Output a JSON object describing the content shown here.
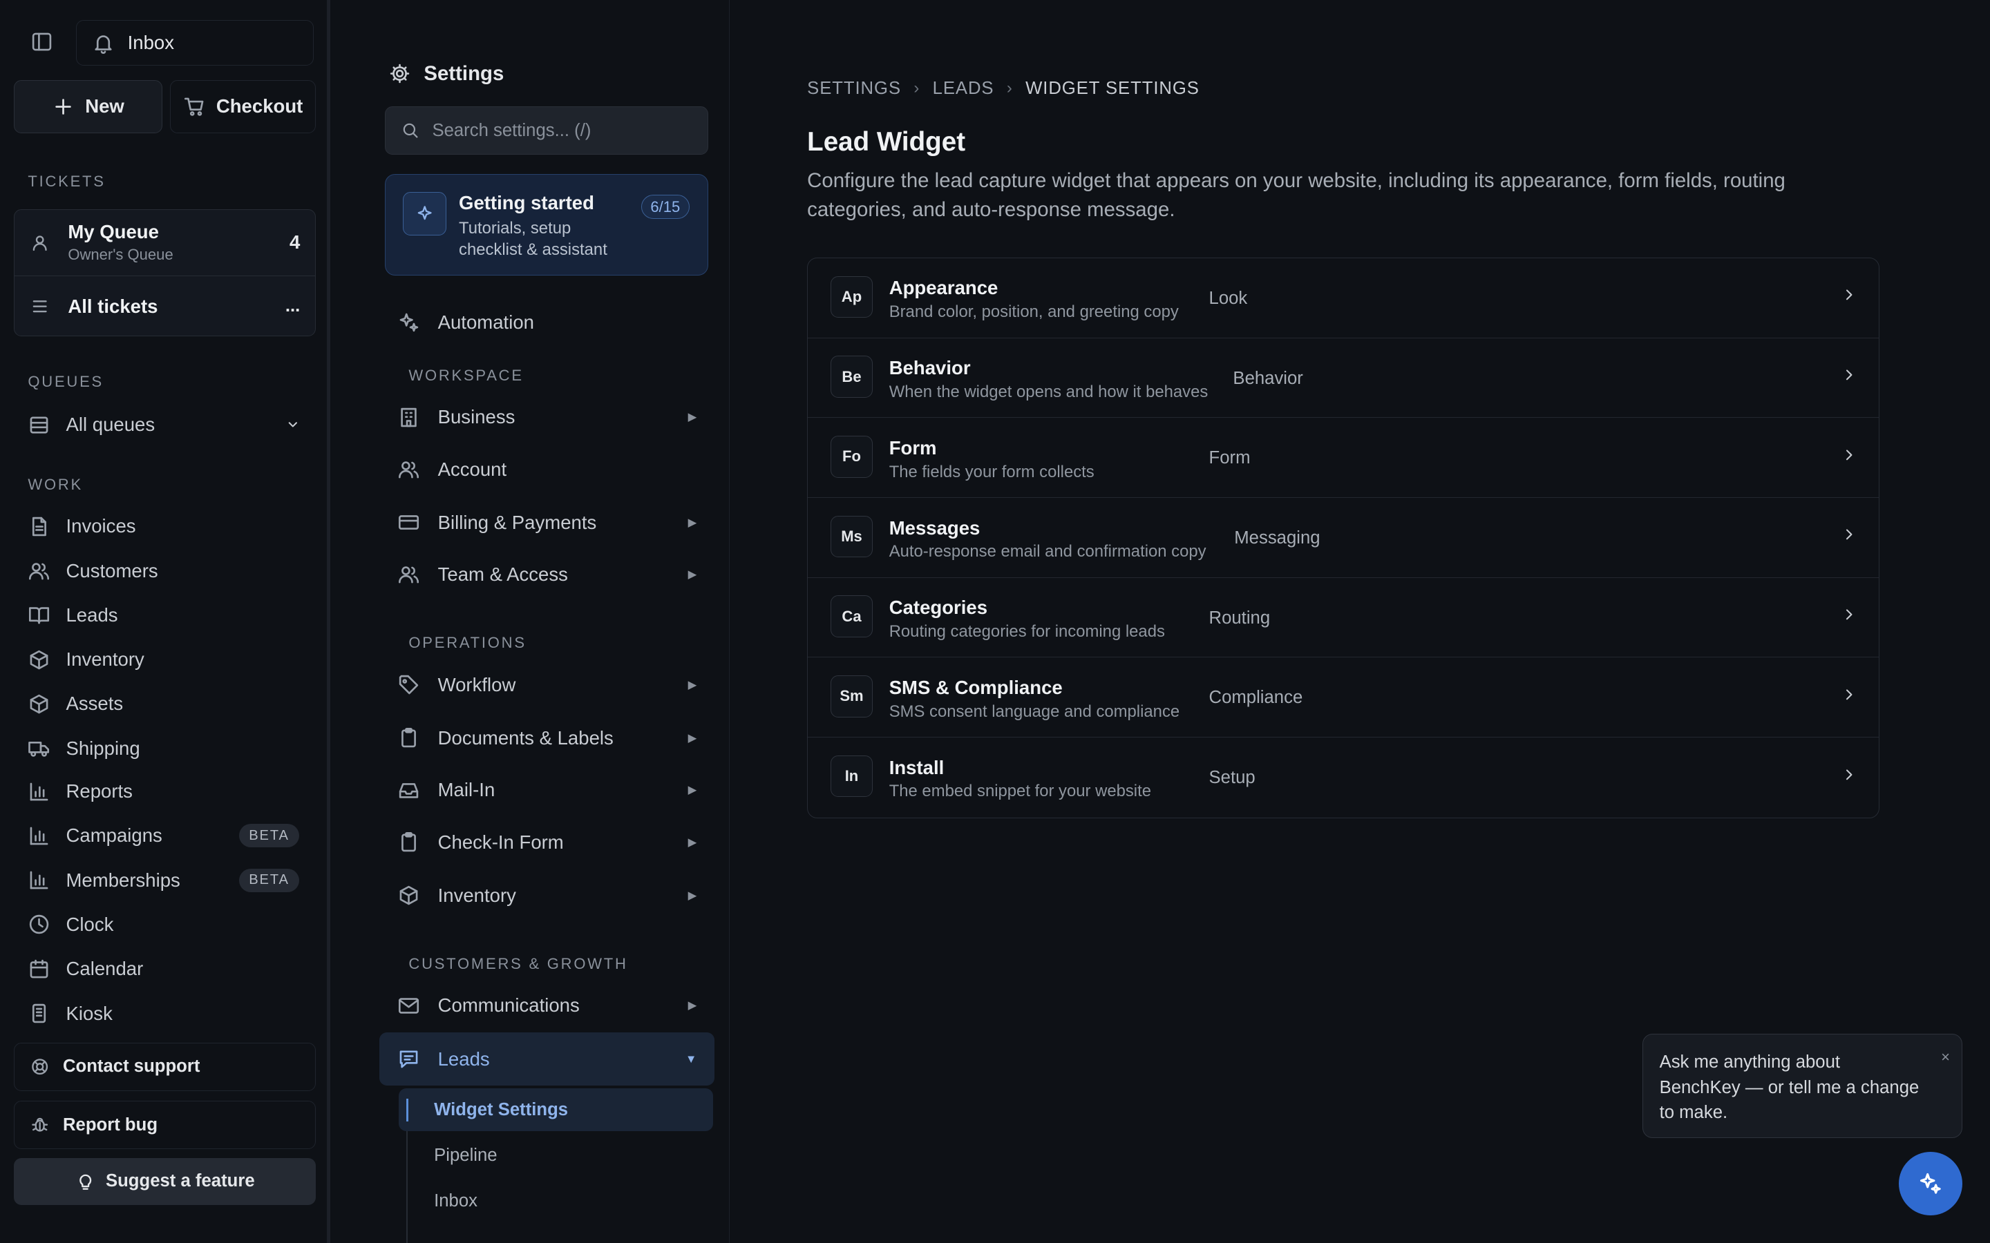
{
  "sidebar": {
    "inbox_label": "Inbox",
    "new_label": "New",
    "checkout_label": "Checkout",
    "tickets_heading": "TICKETS",
    "my_queue": {
      "title": "My Queue",
      "subtitle": "Owner's Queue",
      "count": "4"
    },
    "all_tickets": {
      "title": "All tickets",
      "more": "..."
    },
    "queues_heading": "QUEUES",
    "all_queues_label": "All queues",
    "work_heading": "WORK",
    "work_items": [
      {
        "label": "Invoices",
        "icon": "file-icon"
      },
      {
        "label": "Customers",
        "icon": "users-icon"
      },
      {
        "label": "Leads",
        "icon": "book-icon"
      },
      {
        "label": "Inventory",
        "icon": "box-icon"
      },
      {
        "label": "Assets",
        "icon": "box-icon"
      },
      {
        "label": "Shipping",
        "icon": "truck-icon"
      },
      {
        "label": "Reports",
        "icon": "bar-chart-icon"
      },
      {
        "label": "Campaigns",
        "icon": "bar-chart-icon",
        "badge": "BETA"
      },
      {
        "label": "Memberships",
        "icon": "bar-chart-icon",
        "badge": "BETA"
      },
      {
        "label": "Clock",
        "icon": "clock-icon"
      },
      {
        "label": "Calendar",
        "icon": "calendar-icon"
      },
      {
        "label": "Kiosk",
        "icon": "tablet-icon"
      }
    ],
    "contact_support": "Contact support",
    "report_bug": "Report bug",
    "suggest_feature": "Suggest a feature"
  },
  "settings_nav": {
    "title": "Settings",
    "search_placeholder": "Search settings... (/)",
    "getting_started": {
      "title": "Getting started",
      "subtitle": "Tutorials, setup checklist & assistant",
      "progress": "6/15"
    },
    "automation": "Automation",
    "workspace_heading": "WORKSPACE",
    "workspace_items": [
      "Business",
      "Account",
      "Billing & Payments",
      "Team & Access"
    ],
    "operations_heading": "OPERATIONS",
    "operations_items": [
      "Workflow",
      "Documents & Labels",
      "Mail-In",
      "Check-In Form",
      "Inventory"
    ],
    "growth_heading": "CUSTOMERS & GROWTH",
    "growth_items": [
      "Communications",
      "Leads"
    ],
    "leads_subitems": [
      "Widget Settings",
      "Pipeline",
      "Inbox"
    ]
  },
  "main": {
    "breadcrumb": [
      "SETTINGS",
      "LEADS",
      "WIDGET SETTINGS"
    ],
    "title": "Lead Widget",
    "description": "Configure the lead capture widget that appears on your website, including its appearance, form fields, routing categories, and auto-response message.",
    "sections": [
      {
        "abbr": "Ap",
        "title": "Appearance",
        "desc": "Brand color, position, and greeting copy",
        "tag": "Look"
      },
      {
        "abbr": "Be",
        "title": "Behavior",
        "desc": "When the widget opens and how it behaves",
        "tag": "Behavior"
      },
      {
        "abbr": "Fo",
        "title": "Form",
        "desc": "The fields your form collects",
        "tag": "Form"
      },
      {
        "abbr": "Ms",
        "title": "Messages",
        "desc": "Auto-response email and confirmation copy",
        "tag": "Messaging"
      },
      {
        "abbr": "Ca",
        "title": "Categories",
        "desc": "Routing categories for incoming leads",
        "tag": "Routing"
      },
      {
        "abbr": "Sm",
        "title": "SMS & Compliance",
        "desc": "SMS consent language and compliance",
        "tag": "Compliance"
      },
      {
        "abbr": "In",
        "title": "Install",
        "desc": "The embed snippet for your website",
        "tag": "Setup"
      }
    ]
  },
  "assistant": {
    "message": "Ask me anything about BenchKey — or tell me a change to make.",
    "close": "×"
  }
}
